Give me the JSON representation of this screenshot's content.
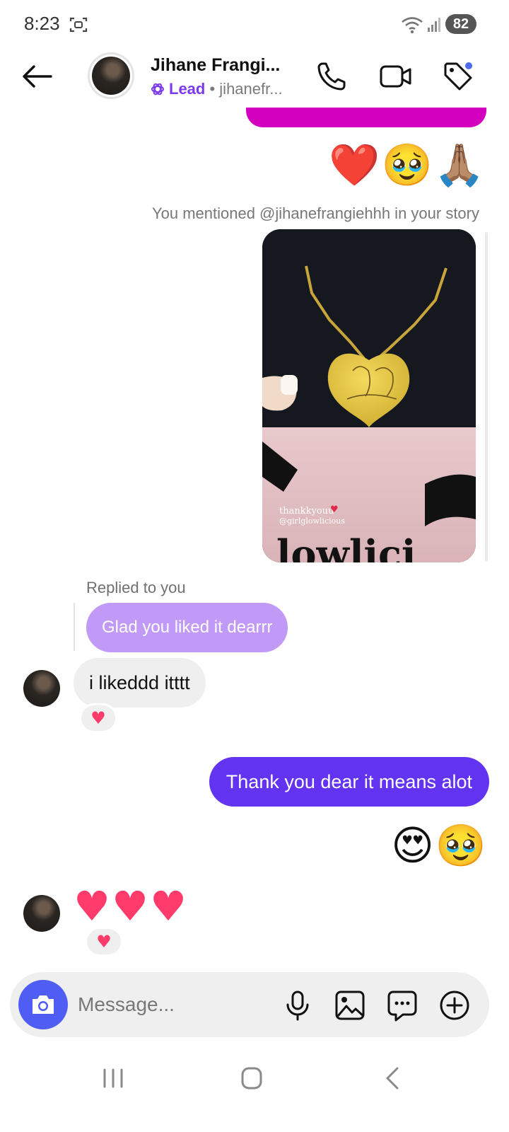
{
  "status_bar": {
    "time": "8:23",
    "battery": "82"
  },
  "header": {
    "contact_name": "Jihane Frangi...",
    "lead_label": "Lead",
    "username_sep": " • ",
    "username": "jihanefr..."
  },
  "chat": {
    "emoji_row_top": "❤️🥹🙏🏽",
    "mention_note": "You mentioned @jihanefrangiehhh in your story",
    "story_caption": "thankkyouu",
    "story_tag": "@girlglowlicious",
    "story_brand": "lowlici",
    "replied_label": "Replied to you",
    "reply_text": "Glad you liked it dearrr",
    "incoming_text": "i likeddd itttt",
    "reaction_1": "♥",
    "outgoing_text": "Thank you dear it means alot",
    "emoji_row_sent": "😍🥹",
    "emoji_row_received": "♥♥♥",
    "reaction_2": "♥"
  },
  "composer": {
    "placeholder": "Message..."
  },
  "colors": {
    "accent": "#6233f0",
    "reply_bubble": "#c19af8",
    "lead": "#7c3aed",
    "camera_button": "#4f5df5",
    "heart": "#ff3b6b"
  },
  "icons": [
    "screen-record-icon",
    "wifi-icon",
    "signal-icon",
    "back-arrow-icon",
    "phone-icon",
    "video-camera-icon",
    "tag-icon",
    "camera-icon",
    "microphone-icon",
    "gallery-icon",
    "sticker-icon",
    "plus-icon",
    "recent-apps-icon",
    "home-icon",
    "nav-back-icon"
  ]
}
